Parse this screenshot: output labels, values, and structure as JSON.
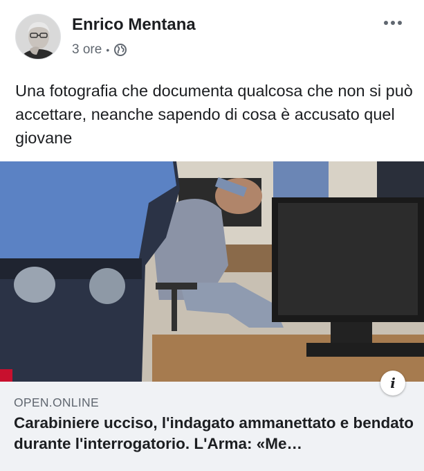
{
  "post": {
    "author": "Enrico Mentana",
    "time": "3 ore",
    "separator": "•",
    "audience_icon": "globe-icon",
    "more_icon": "more-horizontal-icon",
    "text": "Una fotografia che documenta qualcosa che non si può accettare, neanche sapendo di cosa è accusato quel giovane"
  },
  "link_preview": {
    "domain": "OPEN.ONLINE",
    "title": "Carabiniere ucciso, l'indagato ammanettato e bendato durante l'interrogatorio. L'Arma: «Me…",
    "info_icon": "info-icon",
    "info_label": "i"
  },
  "colors": {
    "text_primary": "#1c1e21",
    "text_secondary": "#606770",
    "preview_bg": "#f0f2f5"
  }
}
